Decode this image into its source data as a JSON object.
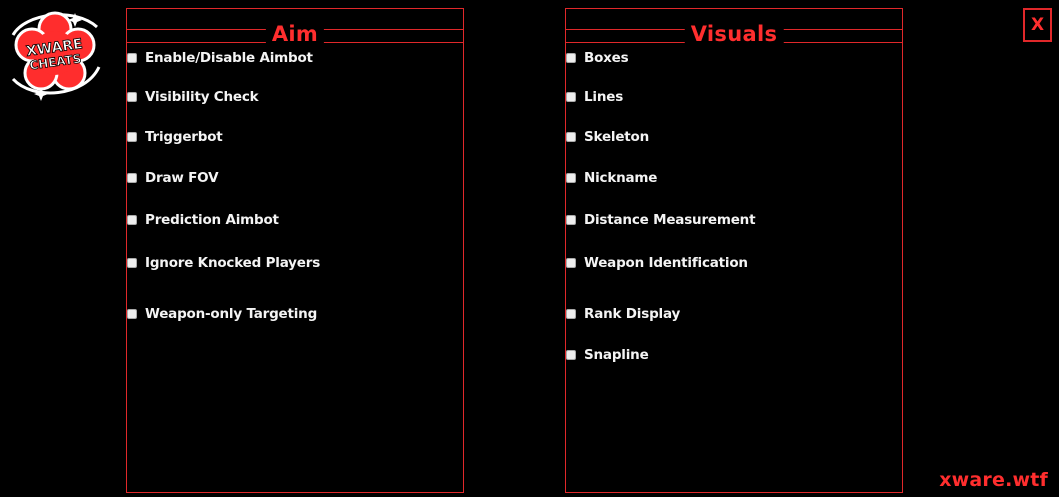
{
  "logo": {
    "line1": "XWARE",
    "line2": "CHEATS",
    "colors": {
      "flower": "#ff2d2d",
      "outline": "#ffffff"
    }
  },
  "aim": {
    "title": "Aim",
    "options": [
      {
        "label": "Enable/Disable Aimbot",
        "checked": false
      },
      {
        "label": "Visibility Check",
        "checked": false
      },
      {
        "label": "Triggerbot",
        "checked": false
      },
      {
        "label": "Draw FOV",
        "checked": false
      },
      {
        "label": "Prediction Aimbot",
        "checked": false
      },
      {
        "label": "Ignore Knocked Players",
        "checked": false
      },
      {
        "label": "Weapon-only Targeting",
        "checked": false
      }
    ]
  },
  "visuals": {
    "title": "Visuals",
    "options": [
      {
        "label": "Boxes",
        "checked": false
      },
      {
        "label": "Lines",
        "checked": false
      },
      {
        "label": "Skeleton",
        "checked": false
      },
      {
        "label": "Nickname",
        "checked": false
      },
      {
        "label": "Distance Measurement",
        "checked": false
      },
      {
        "label": "Weapon Identification",
        "checked": false
      },
      {
        "label": "Rank Display",
        "checked": false
      },
      {
        "label": "Snapline",
        "checked": false
      }
    ]
  },
  "close_label": "X",
  "footer": {
    "brand": "xware.wtf"
  },
  "colors": {
    "accent": "#ff2e2e",
    "border": "#e0282a",
    "background": "#000000"
  }
}
